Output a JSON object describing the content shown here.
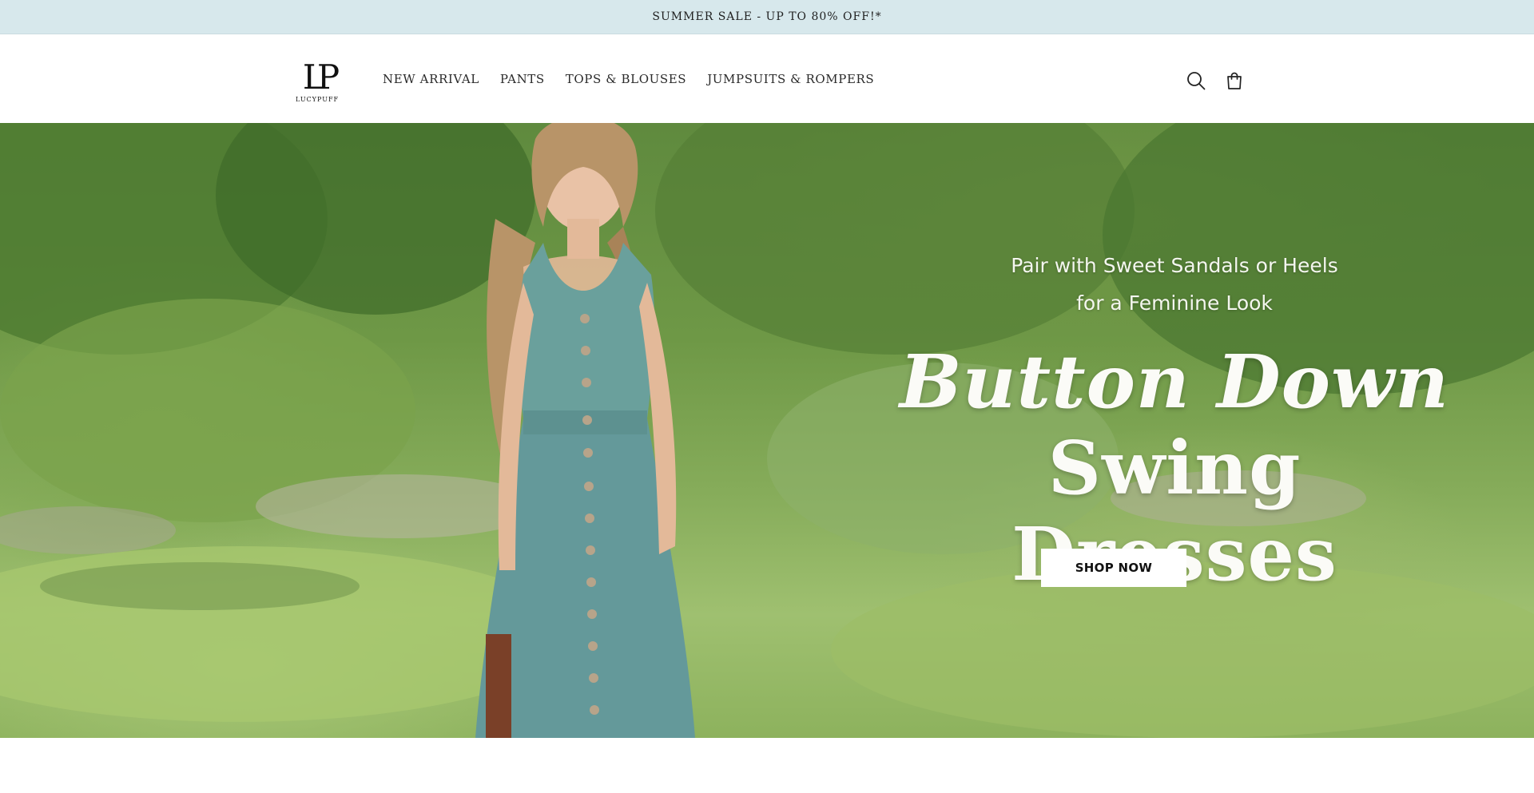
{
  "announcement": {
    "text": "SUMMER SALE - UP TO 80% OFF!*"
  },
  "header": {
    "logo": {
      "mark": "LP",
      "name": "LUCYPUFF"
    },
    "nav": [
      {
        "label": "NEW ARRIVAL"
      },
      {
        "label": "PANTS"
      },
      {
        "label": "TOPS & BLOUSES"
      },
      {
        "label": "JUMPSUITS & ROMPERS"
      }
    ],
    "icons": {
      "search": "search-icon",
      "cart": "cart-icon"
    }
  },
  "hero": {
    "subtitle_line1": "Pair with Sweet Sandals or Heels",
    "subtitle_line2": "for a Feminine Look",
    "title_line1": "Button Down",
    "title_line2": "Swing Dresses",
    "cta_label": "SHOP NOW",
    "colors": {
      "dress": "#6aa09c",
      "foliage": "#6e9846",
      "text": "#fbfbf7"
    }
  },
  "colors": {
    "announcement_bg": "#d7e8ec",
    "header_bg": "#ffffff",
    "button_bg": "#ffffff"
  }
}
